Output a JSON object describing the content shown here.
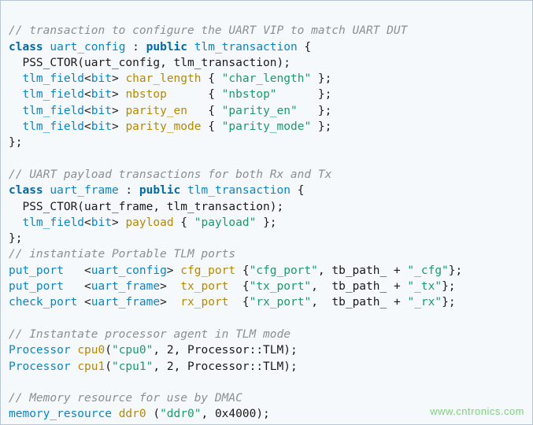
{
  "comments": {
    "cfg": "// transaction to configure the UART VIP to match UART DUT",
    "frame": "// UART payload transactions for both Rx and Tx",
    "ports": "// instantiate Portable TLM ports",
    "proc": "// Instantate processor agent in TLM mode",
    "mem": "// Memory resource for use by DMAC"
  },
  "uart_config": {
    "class_kw": "class",
    "name": "uart_config",
    "public_kw": "public",
    "base": "tlm_transaction",
    "ctor": "PSS_CTOR(uart_config, tlm_transaction);",
    "field_type": "tlm_field",
    "bit": "bit",
    "fields": {
      "char_length": {
        "name": "char_length",
        "str": "\"char_length\""
      },
      "nbstop": {
        "name": "nbstop",
        "str": "\"nbstop\""
      },
      "parity_en": {
        "name": "parity_en",
        "str": "\"parity_en\""
      },
      "parity_mode": {
        "name": "parity_mode",
        "str": "\"parity_mode\""
      }
    }
  },
  "uart_frame": {
    "class_kw": "class",
    "name": "uart_frame",
    "public_kw": "public",
    "base": "tlm_transaction",
    "ctor": "PSS_CTOR(uart_frame, tlm_transaction);",
    "field_type": "tlm_field",
    "bit": "bit",
    "payload": {
      "name": "payload",
      "str": "\"payload\""
    }
  },
  "ports": {
    "put_port": "put_port",
    "check_port": "check_port",
    "uart_config": "uart_config",
    "uart_frame": "uart_frame",
    "cfg": {
      "name": "cfg_port",
      "str": "\"cfg_port\"",
      "path": "tb_path_",
      "suffix": "\"_cfg\""
    },
    "tx": {
      "name": "tx_port",
      "str": "\"tx_port\"",
      "path": "tb_path_",
      "suffix": "\"_tx\""
    },
    "rx": {
      "name": "rx_port",
      "str": "\"rx_port\"",
      "path": "tb_path_",
      "suffix": "\"_rx\""
    }
  },
  "processors": {
    "type": "Processor",
    "mode": "Processor::TLM",
    "cpu0": {
      "name": "cpu0",
      "str": "\"cpu0\"",
      "arg": "2"
    },
    "cpu1": {
      "name": "cpu1",
      "str": "\"cpu1\"",
      "arg": "2"
    }
  },
  "memory": {
    "type": "memory_resource",
    "name": "ddr0",
    "str": "\"ddr0\"",
    "size": "0x4000"
  },
  "watermark": "www.cntronics.com"
}
